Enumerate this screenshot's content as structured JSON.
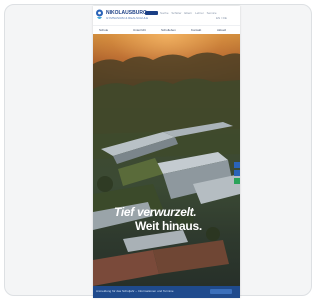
{
  "header": {
    "brand": "NIKOLAUSBURG",
    "brand_sub": "GYMNASIUM & REALSCHULE",
    "util_links": [
      "Suche",
      "Schüler",
      "Eltern",
      "Lehrer",
      "Service"
    ],
    "util_sub": "EN / DE"
  },
  "nav": {
    "items": [
      "Schule",
      "Unterricht",
      "Schulleben",
      "Kontakt",
      "Aktuell"
    ]
  },
  "hero": {
    "line1": "Tief verwurzelt.",
    "line2": "Weit hinaus."
  },
  "footer": {
    "text": "Anmeldung für das Schuljahr – Informationen und Termine"
  },
  "colors": {
    "brand_blue": "#1b3f86",
    "side_blue": "#2a63b8",
    "side_green": "#2aa35a"
  }
}
